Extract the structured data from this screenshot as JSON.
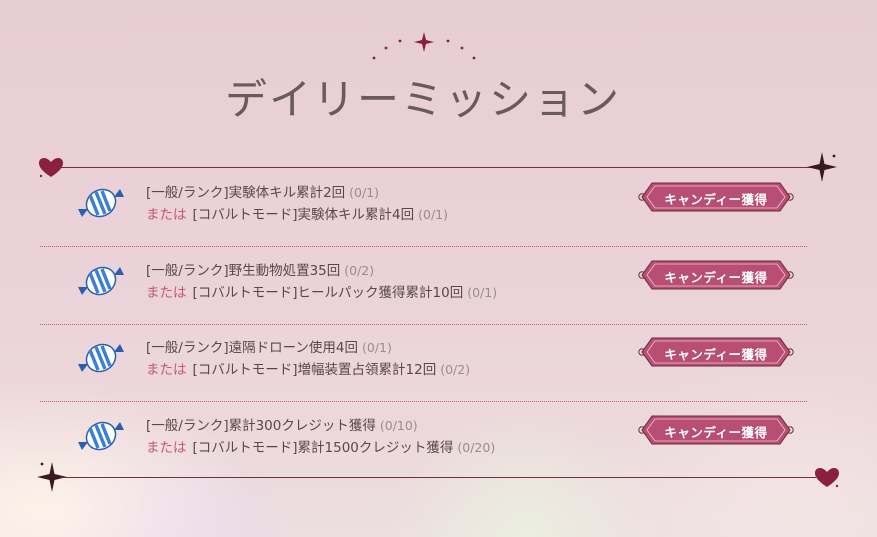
{
  "screen": {
    "title": "デイリーミッション"
  },
  "missions": [
    {
      "icon": "candy-icon",
      "task1": "[一般/ランク]実験体キル累計2回",
      "progress1": "(0/1)",
      "or_label": "または",
      "task2": "[コバルトモード]実験体キル累計4回",
      "progress2": "(0/1)",
      "button_label": "キャンディー獲得"
    },
    {
      "icon": "candy-icon",
      "task1": "[一般/ランク]野生動物処置35回",
      "progress1": "(0/2)",
      "or_label": "または",
      "task2": "[コバルトモード]ヒールパック獲得累計10回",
      "progress2": "(0/1)",
      "button_label": "キャンディー獲得"
    },
    {
      "icon": "candy-icon",
      "task1": "[一般/ランク]遠隔ドローン使用4回",
      "progress1": "(0/1)",
      "or_label": "または",
      "task2": "[コバルトモード]増幅装置占領累計12回",
      "progress2": "(0/2)",
      "button_label": "キャンディー獲得"
    },
    {
      "icon": "candy-icon",
      "task1": "[一般/ランク]累計300クレジット獲得",
      "progress1": "(0/10)",
      "or_label": "または",
      "task2": "[コバルトモード]累計1500クレジット獲得",
      "progress2": "(0/20)",
      "button_label": "キャンディー獲得"
    }
  ],
  "colors": {
    "accent": "#b84e74",
    "frame": "#7a2c3c",
    "heart": "#8a1f3f",
    "candy_blue": "#3b7fd6"
  }
}
